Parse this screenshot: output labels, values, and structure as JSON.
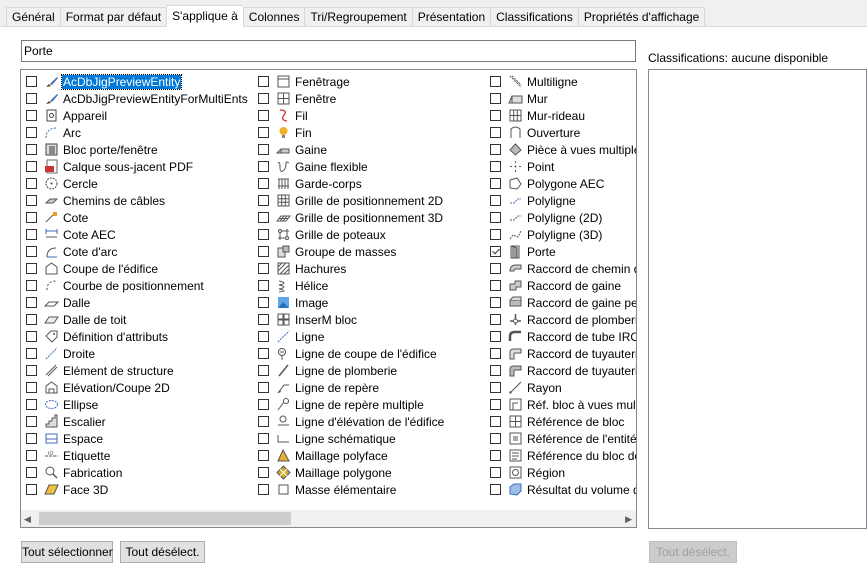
{
  "tabs": [
    "Général",
    "Format par défaut",
    "S'applique à",
    "Colonnes",
    "Tri/Regroupement",
    "Présentation",
    "Classifications",
    "Propriétés d'affichage"
  ],
  "active_tab": 2,
  "name_value": "Porte",
  "classifications_label": "Classifications: aucune disponible",
  "buttons": {
    "select_all": "Tout sélectionner",
    "deselect_all": "Tout désélect.",
    "class_deselect_all": "Tout désélect."
  },
  "columns": [
    [
      {
        "label": "AcDbJigPreviewEntity",
        "icon": "brush-icon",
        "checked": false,
        "selected": true
      },
      {
        "label": "AcDbJigPreviewEntityForMultiEnts",
        "icon": "brush-icon",
        "checked": false
      },
      {
        "label": "Appareil",
        "icon": "device-icon",
        "checked": false
      },
      {
        "label": "Arc",
        "icon": "arc-icon",
        "checked": false
      },
      {
        "label": "Bloc porte/fenêtre",
        "icon": "door-window-block-icon",
        "checked": false
      },
      {
        "label": "Calque sous-jacent PDF",
        "icon": "pdf-icon",
        "checked": false
      },
      {
        "label": "Cercle",
        "icon": "circle-icon",
        "checked": false
      },
      {
        "label": "Chemins de câbles",
        "icon": "cable-tray-icon",
        "checked": false
      },
      {
        "label": "Cote",
        "icon": "dimension-icon",
        "checked": false
      },
      {
        "label": "Cote AEC",
        "icon": "aec-dimension-icon",
        "checked": false
      },
      {
        "label": "Cote d'arc",
        "icon": "arc-dimension-icon",
        "checked": false
      },
      {
        "label": "Coupe de l'édifice",
        "icon": "building-section-icon",
        "checked": false
      },
      {
        "label": "Courbe de positionnement",
        "icon": "layout-curve-icon",
        "checked": false
      },
      {
        "label": "Dalle",
        "icon": "slab-icon",
        "checked": false
      },
      {
        "label": "Dalle de toit",
        "icon": "roof-slab-icon",
        "checked": false
      },
      {
        "label": "Définition d'attributs",
        "icon": "tag-icon",
        "checked": false
      },
      {
        "label": "Droite",
        "icon": "line-icon",
        "checked": false
      },
      {
        "label": "Elément de structure",
        "icon": "structural-member-icon",
        "checked": false
      },
      {
        "label": "Elévation/Coupe 2D",
        "icon": "elevation-icon",
        "checked": false
      },
      {
        "label": "Ellipse",
        "icon": "ellipse-icon",
        "checked": false
      },
      {
        "label": "Escalier",
        "icon": "stair-icon",
        "checked": false
      },
      {
        "label": "Espace",
        "icon": "space-icon",
        "checked": false
      },
      {
        "label": "Etiquette",
        "icon": "label-icon",
        "checked": false
      },
      {
        "label": "Fabrication",
        "icon": "fabrication-icon",
        "checked": false
      },
      {
        "label": "Face 3D",
        "icon": "face3d-icon",
        "checked": false
      }
    ],
    [
      {
        "label": "Fenêtrage",
        "icon": "window-assembly-icon",
        "checked": false
      },
      {
        "label": "Fenêtre",
        "icon": "window-icon",
        "checked": false
      },
      {
        "label": "Fil",
        "icon": "wire-icon",
        "checked": false
      },
      {
        "label": "Fin",
        "icon": "bulb-icon",
        "checked": false
      },
      {
        "label": "Gaine",
        "icon": "duct-icon",
        "checked": false
      },
      {
        "label": "Gaine flexible",
        "icon": "flex-duct-icon",
        "checked": false
      },
      {
        "label": "Garde-corps",
        "icon": "railing-icon",
        "checked": false
      },
      {
        "label": "Grille de positionnement 2D",
        "icon": "grid2d-icon",
        "checked": false
      },
      {
        "label": "Grille de positionnement 3D",
        "icon": "grid3d-icon",
        "checked": false
      },
      {
        "label": "Grille de poteaux",
        "icon": "column-grid-icon",
        "checked": false
      },
      {
        "label": "Groupe de masses",
        "icon": "mass-group-icon",
        "checked": false
      },
      {
        "label": "Hachures",
        "icon": "hatch-icon",
        "checked": false
      },
      {
        "label": "Hélice",
        "icon": "helix-icon",
        "checked": false
      },
      {
        "label": "Image",
        "icon": "image-icon",
        "checked": false
      },
      {
        "label": "InserM bloc",
        "icon": "minsert-icon",
        "checked": false
      },
      {
        "label": "Ligne",
        "icon": "line-icon",
        "checked": false
      },
      {
        "label": "Ligne de coupe de l'édifice",
        "icon": "section-line-icon",
        "checked": false
      },
      {
        "label": "Ligne de plomberie",
        "icon": "plumbing-line-icon",
        "checked": false
      },
      {
        "label": "Ligne de repère",
        "icon": "leader-icon",
        "checked": false
      },
      {
        "label": "Ligne de repère multiple",
        "icon": "multileader-icon",
        "checked": false
      },
      {
        "label": "Ligne d'élévation de l'édifice",
        "icon": "elevation-line-icon",
        "checked": false
      },
      {
        "label": "Ligne schématique",
        "icon": "schematic-line-icon",
        "checked": false
      },
      {
        "label": "Maillage polyface",
        "icon": "polyface-icon",
        "checked": false
      },
      {
        "label": "Maillage polygone",
        "icon": "polygon-mesh-icon",
        "checked": false
      },
      {
        "label": "Masse élémentaire",
        "icon": "mass-element-icon",
        "checked": false
      }
    ],
    [
      {
        "label": "Multiligne",
        "icon": "mline-icon",
        "checked": false
      },
      {
        "label": "Mur",
        "icon": "wall-icon",
        "checked": false
      },
      {
        "label": "Mur-rideau",
        "icon": "curtain-wall-icon",
        "checked": false
      },
      {
        "label": "Ouverture",
        "icon": "opening-icon",
        "checked": false
      },
      {
        "label": "Pièce à vues multiple",
        "icon": "mvpart-icon",
        "checked": false
      },
      {
        "label": "Point",
        "icon": "point-icon",
        "checked": false
      },
      {
        "label": "Polygone AEC",
        "icon": "aec-polygon-icon",
        "checked": false
      },
      {
        "label": "Polyligne",
        "icon": "polyline-icon",
        "checked": false
      },
      {
        "label": "Polyligne (2D)",
        "icon": "polyline2d-icon",
        "checked": false
      },
      {
        "label": "Polyligne (3D)",
        "icon": "polyline3d-icon",
        "checked": false
      },
      {
        "label": "Porte",
        "icon": "door-icon",
        "checked": true
      },
      {
        "label": "Raccord de chemin d",
        "icon": "tray-fitting-icon",
        "checked": false
      },
      {
        "label": "Raccord de gaine",
        "icon": "duct-fitting-icon",
        "checked": false
      },
      {
        "label": "Raccord de gaine per",
        "icon": "duct-custom-fitting-icon",
        "checked": false
      },
      {
        "label": "Raccord de plomberi",
        "icon": "plumbing-fitting-icon",
        "checked": false
      },
      {
        "label": "Raccord de tube IRO",
        "icon": "conduit-fitting-icon",
        "checked": false
      },
      {
        "label": "Raccord de tuyauteri",
        "icon": "pipe-fitting-icon",
        "checked": false
      },
      {
        "label": "Raccord de tuyauteri",
        "icon": "pipe-custom-fitting-icon",
        "checked": false
      },
      {
        "label": "Rayon",
        "icon": "ray-icon",
        "checked": false
      },
      {
        "label": "Réf. bloc à vues mult",
        "icon": "mvblock-ref-icon",
        "checked": false
      },
      {
        "label": "Référence de bloc",
        "icon": "block-ref-icon",
        "checked": false
      },
      {
        "label": "Référence de l'entité",
        "icon": "entity-ref-icon",
        "checked": false
      },
      {
        "label": "Référence du bloc de",
        "icon": "block-def-ref-icon",
        "checked": false
      },
      {
        "label": "Région",
        "icon": "region-icon",
        "checked": false
      },
      {
        "label": "Résultat du volume d",
        "icon": "volume-result-icon",
        "checked": false
      }
    ]
  ],
  "colors": {
    "selection": "#0078d7",
    "window_bg": "#f0f0f0",
    "list_border": "#828790"
  }
}
